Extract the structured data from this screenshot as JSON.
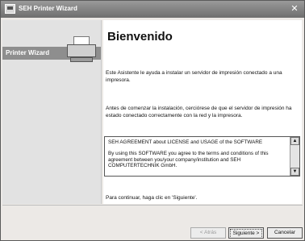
{
  "window": {
    "title": "SEH Printer Wizard",
    "close": "✕"
  },
  "sidebar": {
    "label": "Printer Wizard"
  },
  "content": {
    "heading": "Bienvenido",
    "para1": "Este Asistente le ayuda a instalar un servidor de impresión conectado a una impresora.",
    "para2": "Antes de comenzar la instalación, cerciórese de que el servidor de impresión ha estado conectado correctamente con la red y la impresora.",
    "license": {
      "line1": "SEH AGREEMENT about LICENSE and USAGE of the SOFTWARE",
      "line2": "By using this SOFTWARE you agree to the terms and conditions of this agreement between you/your company/institution and SEH COMPUTERTECHNIK GmbH."
    },
    "continue": "Para continuar, haga clic en 'Siguiente'."
  },
  "buttons": {
    "back": "< Atrás",
    "next": "Siguiente >",
    "cancel": "Cancelar"
  }
}
